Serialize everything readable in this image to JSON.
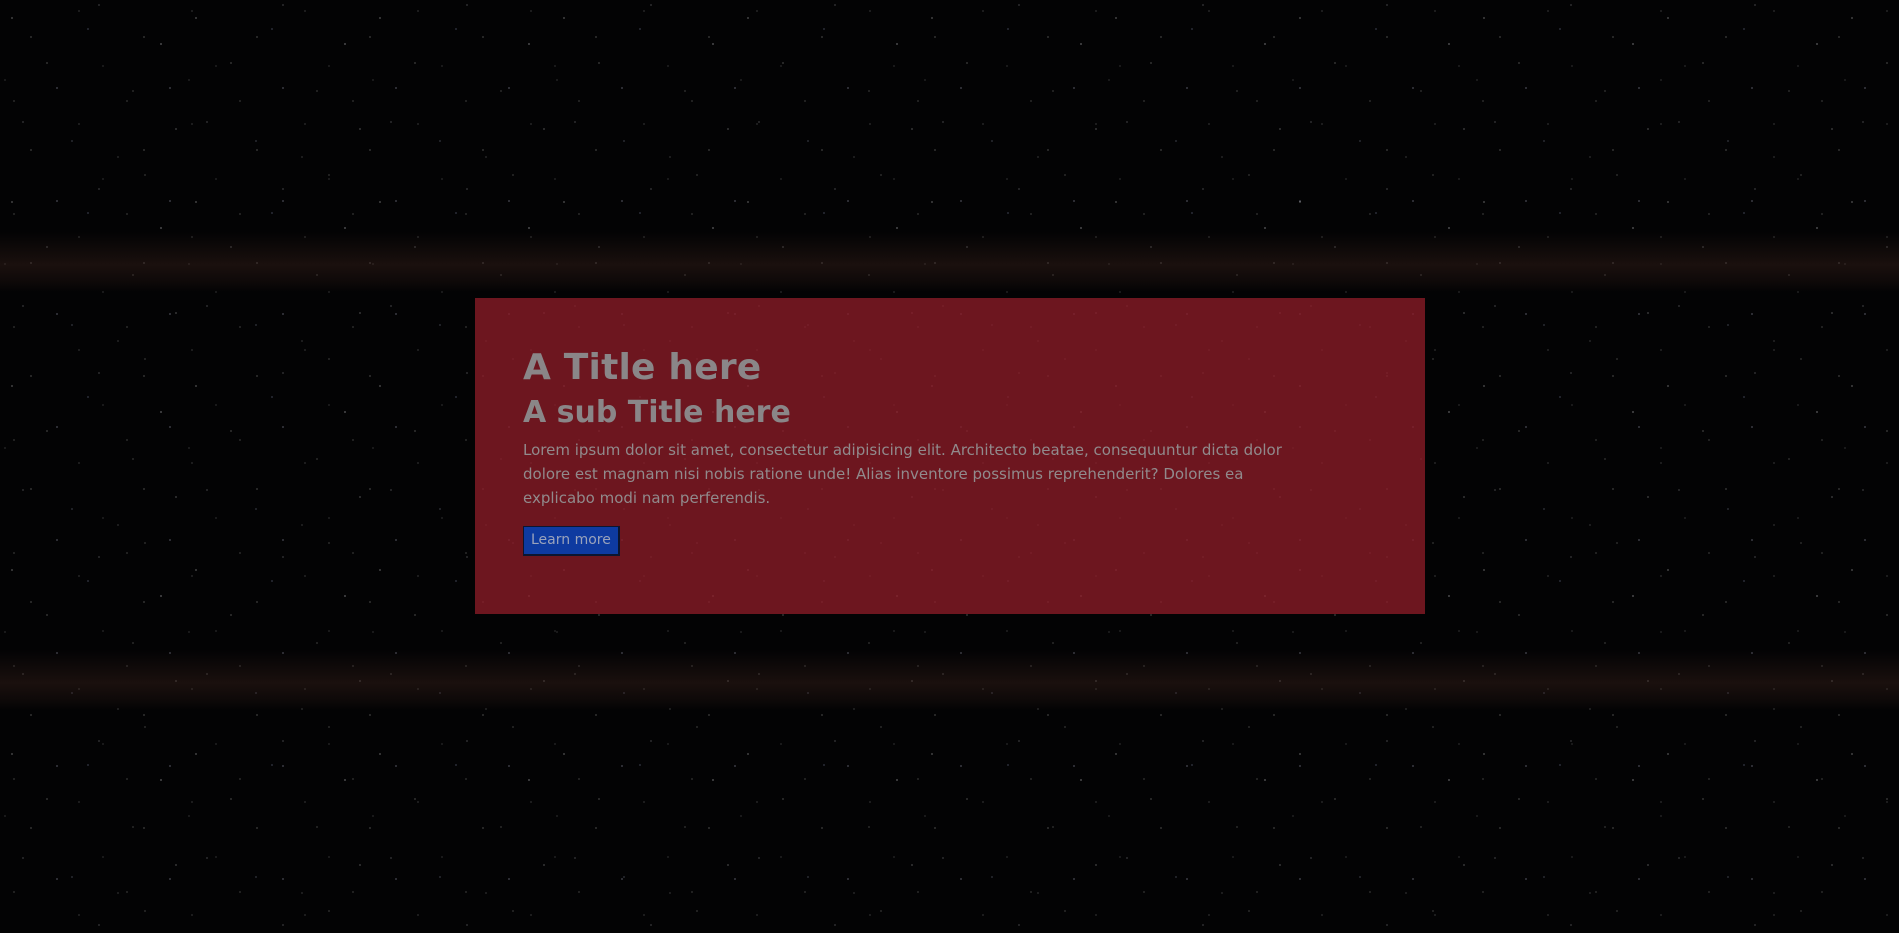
{
  "hero": {
    "title": "A Title here",
    "subtitle": "A sub Title here",
    "body": "Lorem ipsum dolor sit amet, consectetur adipisicing elit. Architecto beatae, consequuntur dicta dolor dolore est magnam nisi nobis ratione unde! Alias inventore possimus reprehenderit? Dolores ea explicabo modi nam perferendis.",
    "cta_label": "Learn more"
  },
  "colors": {
    "background": "#030304",
    "card": "#7a1b26",
    "button": "#0e3aa0",
    "text": "#8a8688"
  }
}
